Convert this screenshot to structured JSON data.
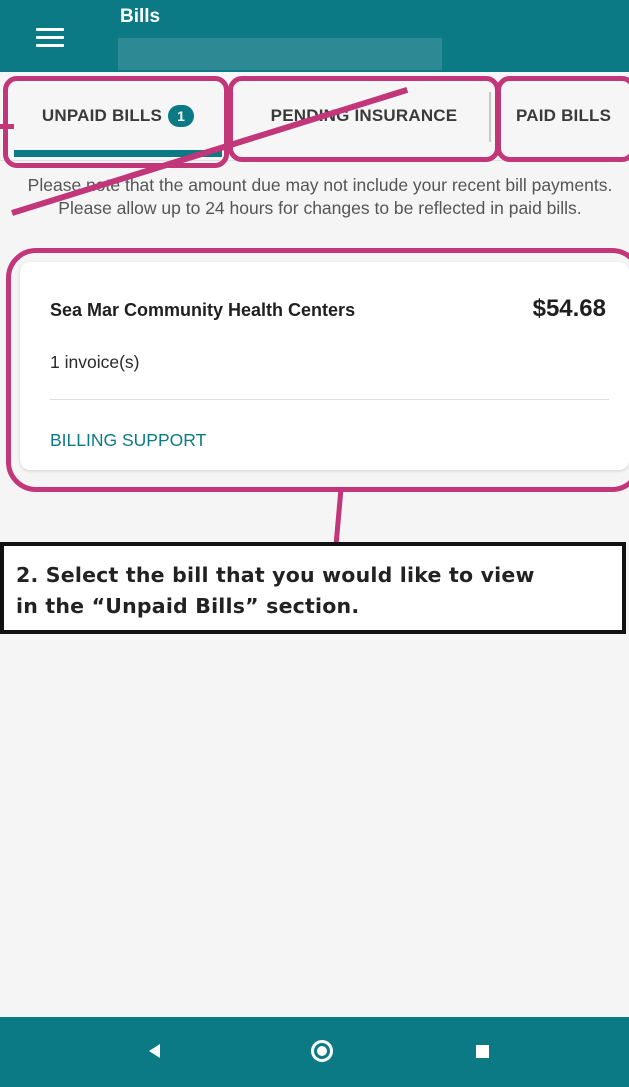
{
  "appbar": {
    "title": "Bills"
  },
  "tabs": {
    "unpaid_label": "UNPAID BILLS",
    "unpaid_count": "1",
    "pending_label": "PENDING INSURANCE",
    "paid_label": "PAID BILLS"
  },
  "notice": "Please note that the amount due may not include your recent bill payments. Please allow up to 24 hours for changes to be reflected in paid bills.",
  "bill_card": {
    "provider": "Sea Mar Community Health Centers",
    "amount": "$54.68",
    "invoices": "1 invoice(s)",
    "support_link": "BILLING SUPPORT"
  },
  "instruction": {
    "line1": "2.  Select the bill that you would like to view",
    "line2": "in the “Unpaid Bills” section."
  },
  "colors": {
    "primary": "#0b7a85",
    "highlight": "#c2367a"
  },
  "navbar": {
    "icons": [
      "back-icon",
      "home-icon",
      "recents-icon"
    ]
  }
}
